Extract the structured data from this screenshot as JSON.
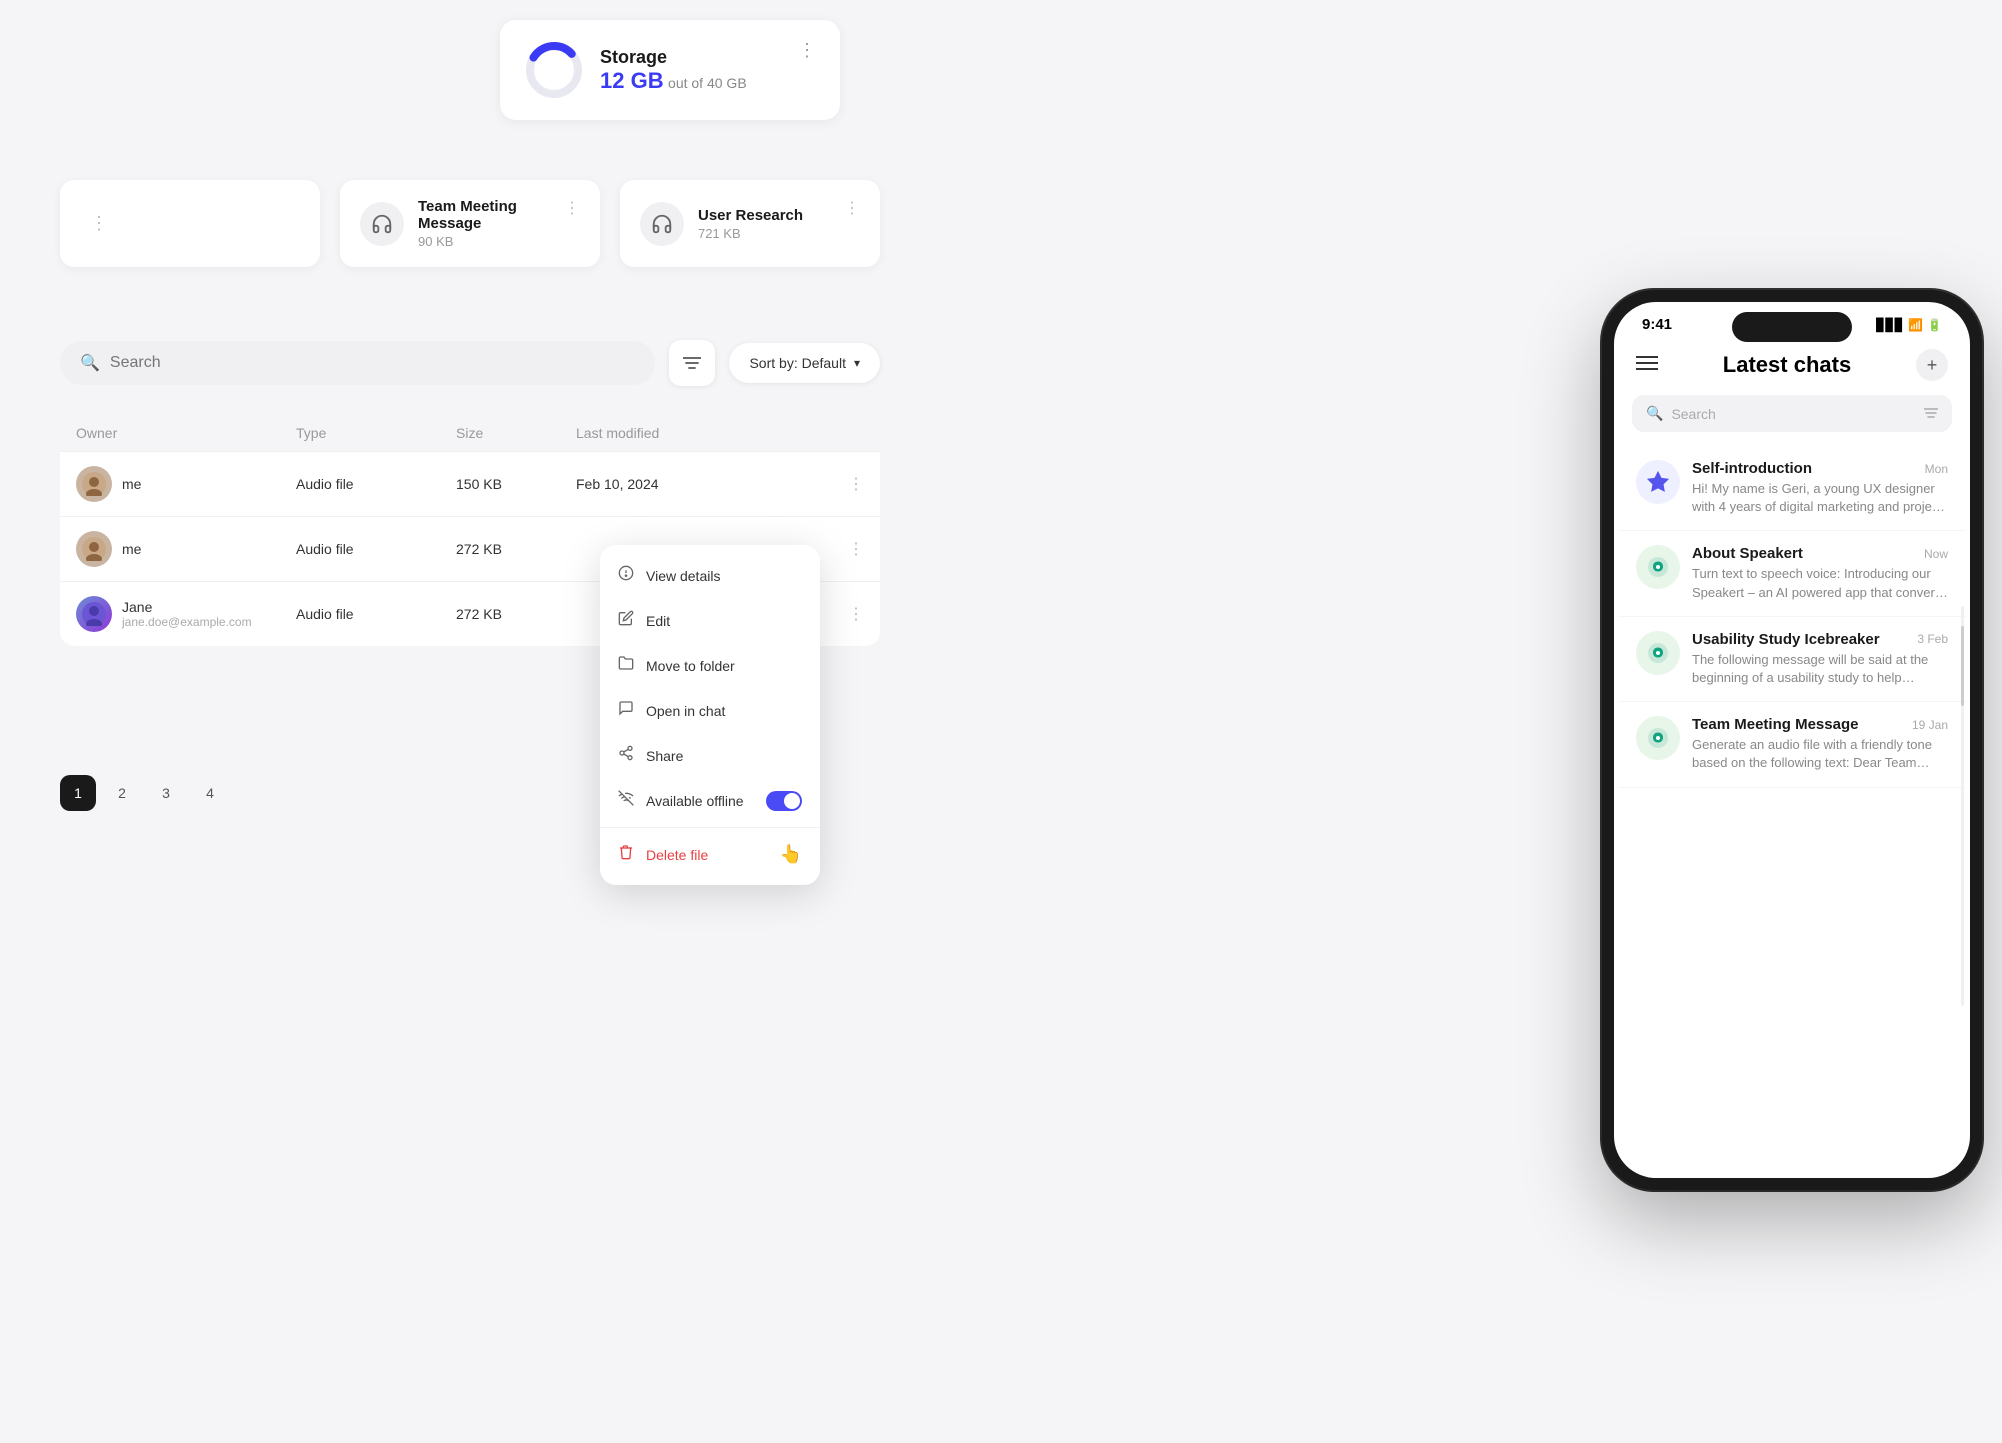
{
  "storage": {
    "title": "Storage",
    "amount": "12 GB",
    "out_of": "out of 40 GB",
    "used_percent": 30,
    "menu": "⋮"
  },
  "file_cards": [
    {
      "name": "Team Meeting Message",
      "size": "90 KB"
    },
    {
      "name": "User Research",
      "size": "721 KB"
    }
  ],
  "search": {
    "placeholder": "Search",
    "sort_label": "Sort by: Default"
  },
  "table": {
    "headers": [
      "Owner",
      "Type",
      "Size",
      "Last modified"
    ],
    "rows": [
      {
        "owner": "me",
        "type": "Audio file",
        "size": "150 KB",
        "date": "Feb 10, 2024"
      },
      {
        "owner": "me",
        "type": "Audio file",
        "size": "272 KB",
        "date": ""
      },
      {
        "owner": "Jane",
        "owner_email": "jane.doe@example.com",
        "type": "Audio file",
        "size": "272 KB",
        "date": ""
      }
    ]
  },
  "context_menu": {
    "items": [
      {
        "icon": "👁",
        "label": "View details"
      },
      {
        "icon": "✏️",
        "label": "Edit"
      },
      {
        "icon": "📁",
        "label": "Move to folder"
      },
      {
        "icon": "💬",
        "label": "Open in chat"
      },
      {
        "icon": "📤",
        "label": "Share"
      },
      {
        "icon": "📶",
        "label": "Available offline",
        "has_toggle": true
      },
      {
        "icon": "🗑",
        "label": "Delete file",
        "is_delete": true
      }
    ]
  },
  "pagination": {
    "pages": [
      "1",
      "2",
      "3",
      "4"
    ],
    "active": "1"
  },
  "phone": {
    "status_time": "9:41",
    "title": "Latest chats",
    "search_placeholder": "Search",
    "chats": [
      {
        "name": "Self-introduction",
        "time": "Mon",
        "preview": "Hi! My name is Geri, a young UX designer with 4 years of digital marketing and project management background living in...",
        "avatar_type": "star"
      },
      {
        "name": "About Speakert",
        "time": "Now",
        "preview": "Turn text to speech voice: Introducing our Speakert – an AI powered app that converts text into customizable speech...",
        "avatar_type": "gpt"
      },
      {
        "name": "Usability Study Icebreaker",
        "time": "3 Feb",
        "preview": "The following message will be said at the beginning of a usability study to help participants get comfortable. Generate...",
        "avatar_type": "gpt"
      },
      {
        "name": "Team Meeting Message",
        "time": "19 Jan",
        "preview": "Generate an audio file with a friendly tone based on the following text: Dear Team Members, exciting news...",
        "avatar_type": "gpt"
      }
    ]
  }
}
